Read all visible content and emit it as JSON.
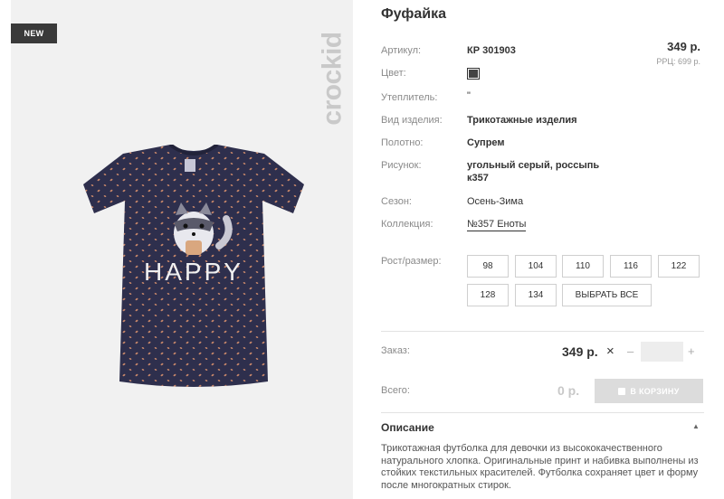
{
  "badge": "NEW",
  "brand": "crockid",
  "product": {
    "title": "Фуфайка",
    "price": "349 р.",
    "rrp": "РРЦ: 699 р."
  },
  "specs": {
    "article_label": "Артикул:",
    "article_value": "КР 301903",
    "color_label": "Цвет:",
    "filler_label": "Утеплитель:",
    "filler_value": "\"",
    "type_label": "Вид изделия:",
    "type_value": "Трикотажные изделия",
    "fabric_label": "Полотно:",
    "fabric_value": "Супрем",
    "pattern_label": "Рисунок:",
    "pattern_value_1": "угольный серый, россыпь",
    "pattern_value_2": "к357",
    "season_label": "Сезон:",
    "season_value": "Осень-Зима",
    "collection_label": "Коллекция:",
    "collection_value": "№357 Еноты"
  },
  "swatch_color": "#444444",
  "sizes": {
    "label": "Рост/размер:",
    "items": [
      "98",
      "104",
      "110",
      "116",
      "122",
      "128",
      "134"
    ],
    "select_all": "ВЫБРАТЬ ВСЕ"
  },
  "order": {
    "label": "Заказ:",
    "price": "349 р.",
    "times": "×",
    "minus": "–",
    "plus": "+"
  },
  "total": {
    "label": "Всего:",
    "value": "0 р.",
    "cart_button": "В КОРЗИНУ"
  },
  "description": {
    "title": "Описание",
    "caret": "▲",
    "lines": [
      "Трикотажная футболка для девочки из высококачественного",
      "натурального хлопка. Оригинальные принт и набивка выполнены из",
      "стойких текстильных красителей. Футболка сохраняет цвет и форму",
      "после многократных стирок."
    ]
  },
  "shirt_print": "HAPPY"
}
